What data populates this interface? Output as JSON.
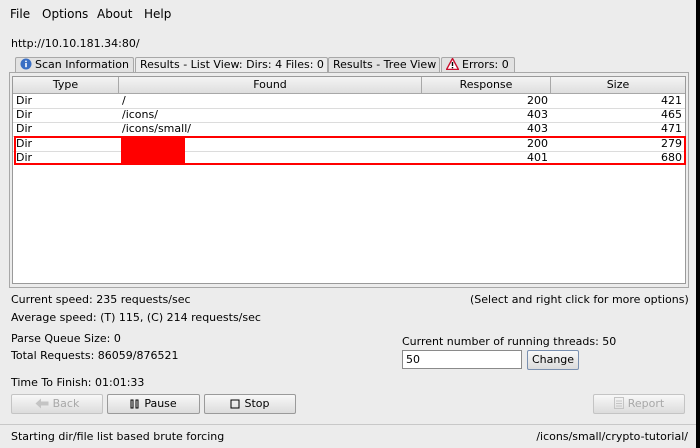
{
  "menu": [
    "File",
    "Options",
    "About",
    "Help"
  ],
  "target_url": "http://10.10.181.34:80/",
  "tabs": [
    {
      "label": "Scan Information",
      "icon": "info-icon"
    },
    {
      "label": "Results - List View: Dirs: 4 Files: 0"
    },
    {
      "label": "Results - Tree View"
    },
    {
      "label": "Errors: 0",
      "icon": "warning-icon"
    }
  ],
  "table": {
    "columns": [
      "Type",
      "Found",
      "Response",
      "Size"
    ],
    "rows": [
      {
        "type": "Dir",
        "found": "/",
        "response": "200",
        "size": "421"
      },
      {
        "type": "Dir",
        "found": "/icons/",
        "response": "403",
        "size": "465"
      },
      {
        "type": "Dir",
        "found": "/icons/small/",
        "response": "403",
        "size": "471"
      },
      {
        "type": "Dir",
        "found": "",
        "response": "200",
        "size": "279"
      },
      {
        "type": "Dir",
        "found": "",
        "response": "401",
        "size": "680"
      }
    ]
  },
  "status": {
    "current_speed": "Current speed: 235 requests/sec",
    "hint": "(Select and right click for more options)",
    "average_speed": "Average speed: (T) 115, (C) 214 requests/sec",
    "parse_queue": "Parse Queue Size: 0",
    "total_requests": "Total Requests: 86059/876521",
    "time_to_finish": "Time To Finish: 01:01:33",
    "threads_label": "Current number of running threads: 50",
    "threads_value": "50"
  },
  "buttons": {
    "back": "Back",
    "pause": "Pause",
    "stop": "Stop",
    "change": "Change",
    "report": "Report"
  },
  "statusbar": {
    "left": "Starting dir/file list based brute forcing",
    "right": "/icons/small/crypto-tutorial/"
  },
  "colors": {
    "highlight": "#ff0000",
    "info": "#3a6fc4",
    "warning": "#c8102e"
  }
}
